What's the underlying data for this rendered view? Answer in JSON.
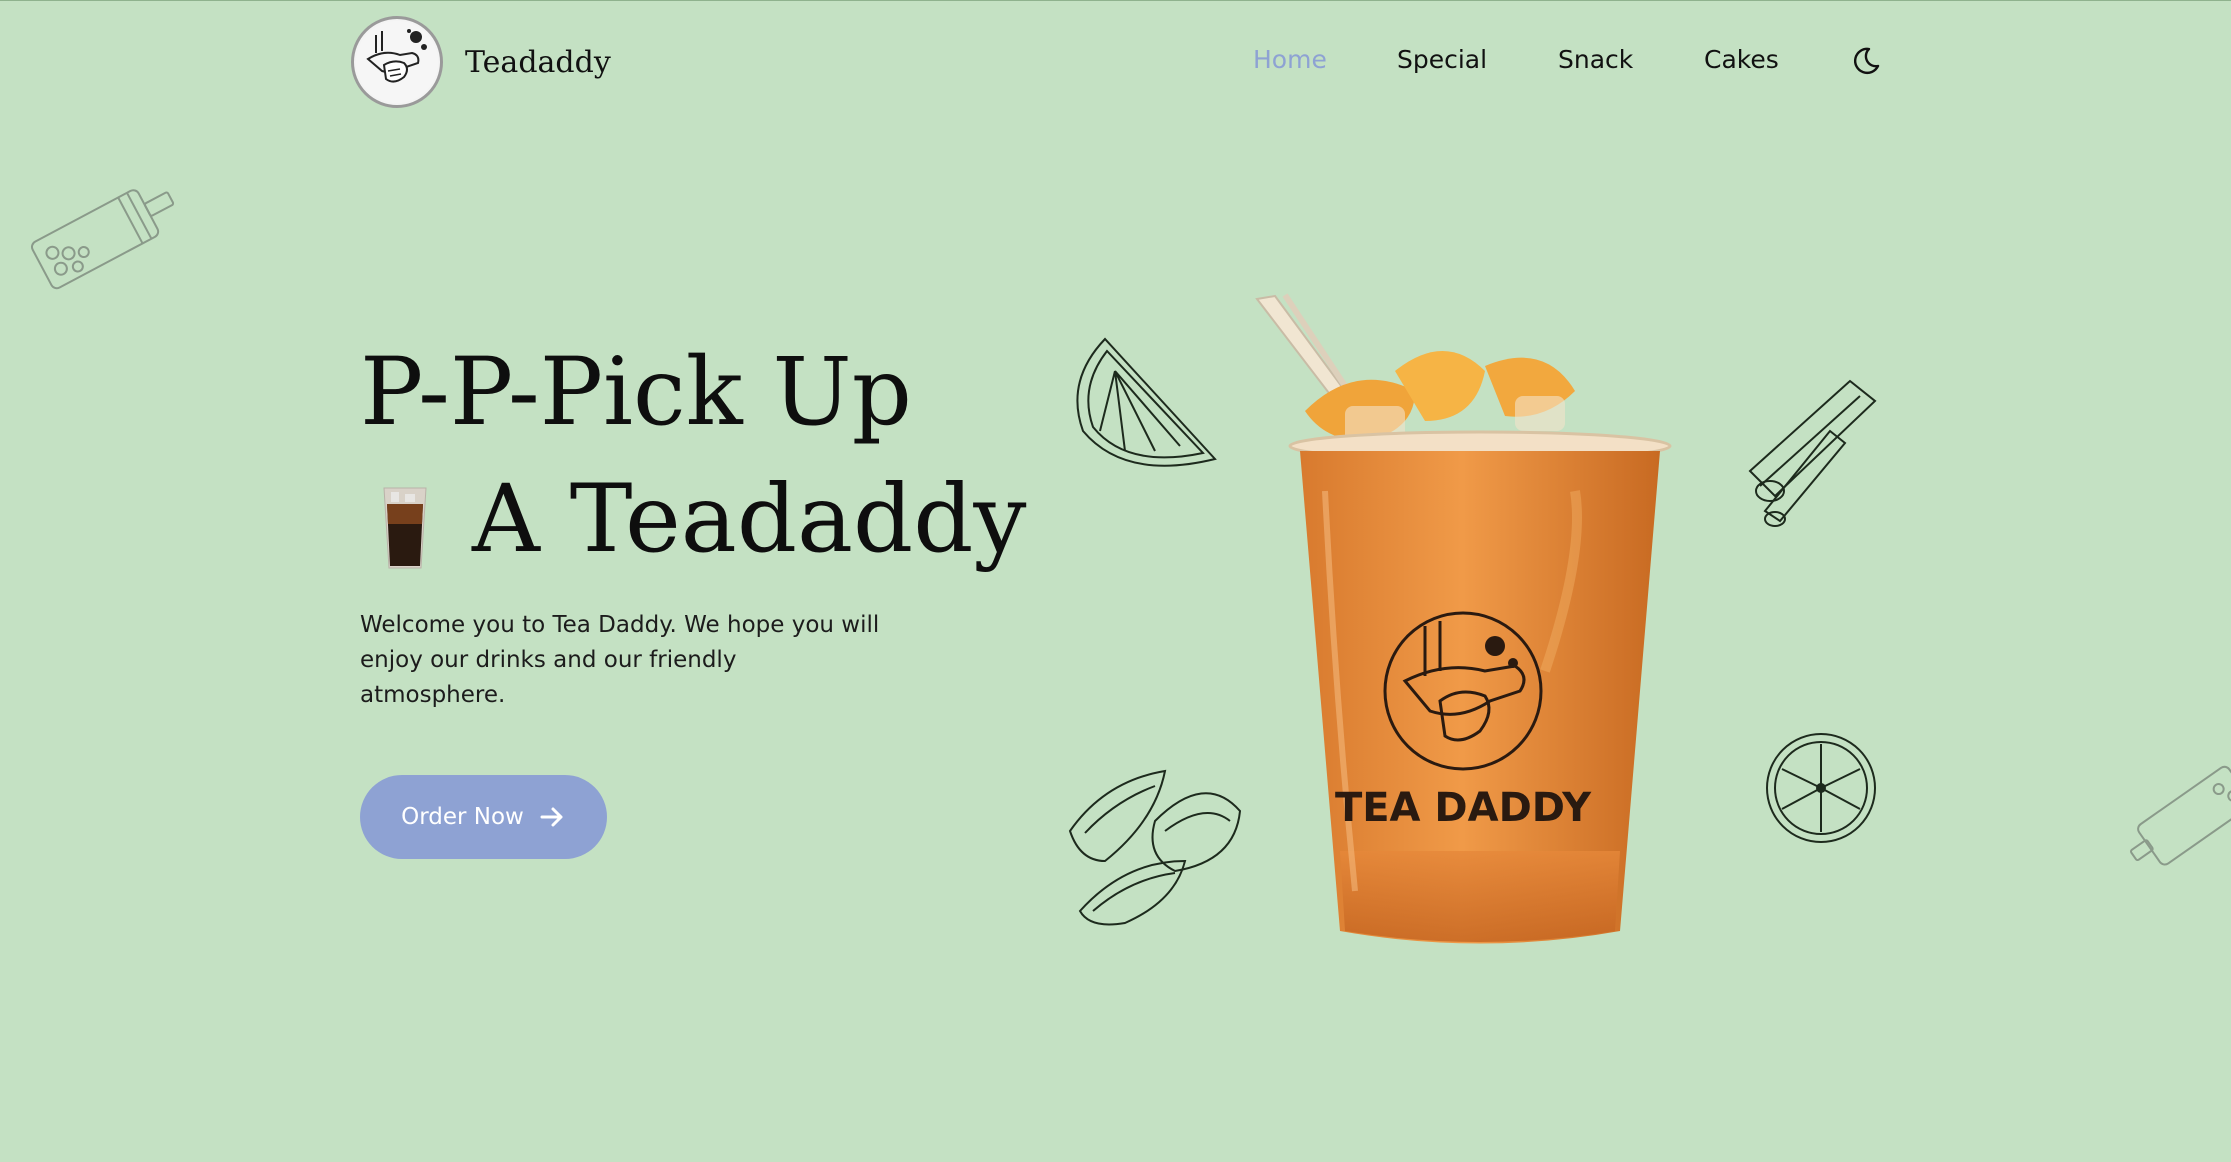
{
  "header": {
    "brand": "Teadaddy",
    "logo_icon": "tea-daddy-handshake-logo-icon",
    "nav": [
      {
        "label": "Home",
        "active": true
      },
      {
        "label": "Special",
        "active": false
      },
      {
        "label": "Snack",
        "active": false
      },
      {
        "label": "Cakes",
        "active": false
      }
    ],
    "theme_toggle_icon": "moon-icon"
  },
  "hero": {
    "line1": "P-P-Pick Up",
    "line2": "A Teadaddy",
    "line2_icon": "iced-tea-cup-icon",
    "description": "Welcome you to Tea Daddy. We hope you will enjoy our drinks and our friendly atmosphere.",
    "cta_label": "Order Now",
    "cta_icon": "arrow-right-icon",
    "drink_cup_text": "TEA DADDY"
  },
  "colors": {
    "background": "#c4e1c3",
    "accent": "#8ea2d3",
    "drink": "#e98a3a"
  }
}
